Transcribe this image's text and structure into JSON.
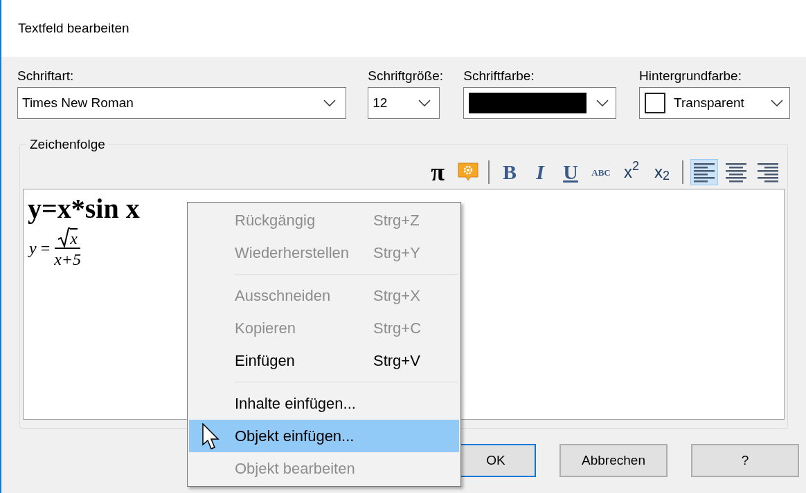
{
  "window": {
    "title": "Textfeld bearbeiten"
  },
  "font": {
    "label": "Schriftart:",
    "value": "Times New Roman"
  },
  "size": {
    "label": "Schriftgröße:",
    "value": "12"
  },
  "font_color": {
    "label": "Schriftfarbe:",
    "color": "#000000"
  },
  "background_color": {
    "label": "Hintergrundfarbe:",
    "value": "Transparent"
  },
  "group": {
    "title": "Zeichenfolge"
  },
  "toolbar": [
    {
      "kind": "glyph",
      "label": "π"
    },
    {
      "kind": "image"
    },
    {
      "kind": "separator"
    },
    {
      "kind": "bold",
      "label": "B"
    },
    {
      "kind": "italic",
      "label": "I"
    },
    {
      "kind": "underline",
      "label": "U"
    },
    {
      "kind": "small",
      "label": "ABC"
    },
    {
      "kind": "script",
      "label": "x$^{2}$"
    },
    {
      "kind": "script",
      "label": "x$_{2}$"
    },
    {
      "kind": "separator"
    },
    {
      "kind": "align-left",
      "selected": true
    },
    {
      "kind": "align-center",
      "selected": false
    },
    {
      "kind": "align-right",
      "selected": false
    }
  ],
  "editor": {
    "line": "y=x*sin x",
    "formula": {
      "lhs": "y",
      "equals": "=",
      "numerator": "x",
      "denominator": "x+5"
    }
  },
  "context_menu": [
    {
      "kind": "item",
      "label": "Rückgängig",
      "shortcut": "Strg+Z",
      "disabled": true,
      "selected": false
    },
    {
      "kind": "item",
      "label": "Wiederherstellen",
      "shortcut": "Strg+Y",
      "disabled": true,
      "selected": false
    },
    {
      "kind": "separator"
    },
    {
      "kind": "item",
      "label": "Ausschneiden",
      "shortcut": "Strg+X",
      "disabled": true,
      "selected": false
    },
    {
      "kind": "item",
      "label": "Kopieren",
      "shortcut": "Strg+C",
      "disabled": true,
      "selected": false
    },
    {
      "kind": "item",
      "label": "Einfügen",
      "shortcut": "Strg+V",
      "disabled": false,
      "selected": false
    },
    {
      "kind": "separator"
    },
    {
      "kind": "item",
      "label": "Inhalte einfügen...",
      "disabled": false,
      "selected": false
    },
    {
      "kind": "item",
      "label": "Objekt einfügen...",
      "disabled": false,
      "selected": true
    },
    {
      "kind": "item",
      "label": "Objekt bearbeiten",
      "disabled": true,
      "selected": false
    }
  ],
  "buttons": [
    {
      "label": "OK",
      "default": true
    },
    {
      "label": "Abbrechen",
      "default": false
    },
    {
      "label": "?",
      "default": false
    }
  ]
}
